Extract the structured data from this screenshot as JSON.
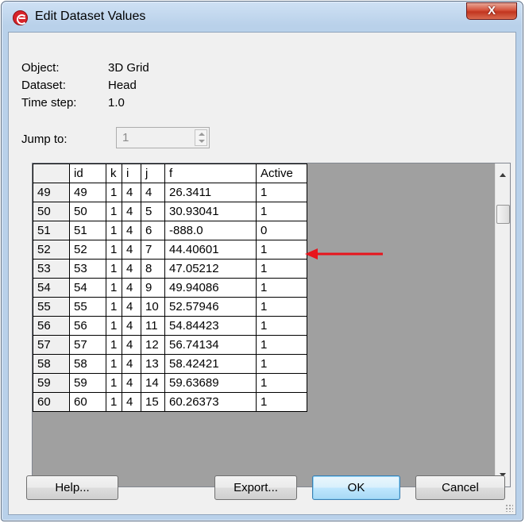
{
  "window": {
    "title": "Edit Dataset Values",
    "close_label": "X"
  },
  "info": {
    "object_label": "Object:",
    "object_value": "3D Grid",
    "dataset_label": "Dataset:",
    "dataset_value": "Head",
    "timestep_label": "Time step:",
    "timestep_value": "1.0"
  },
  "jump": {
    "label": "Jump to:",
    "value": "1"
  },
  "grid": {
    "columns": [
      "",
      "id",
      "k",
      "i",
      "j",
      "f",
      "Active"
    ],
    "rows": [
      [
        "49",
        "49",
        "1",
        "4",
        "4",
        "26.3411",
        "1"
      ],
      [
        "50",
        "50",
        "1",
        "4",
        "5",
        "30.93041",
        "1"
      ],
      [
        "51",
        "51",
        "1",
        "4",
        "6",
        "-888.0",
        "0"
      ],
      [
        "52",
        "52",
        "1",
        "4",
        "7",
        "44.40601",
        "1"
      ],
      [
        "53",
        "53",
        "1",
        "4",
        "8",
        "47.05212",
        "1"
      ],
      [
        "54",
        "54",
        "1",
        "4",
        "9",
        "49.94086",
        "1"
      ],
      [
        "55",
        "55",
        "1",
        "4",
        "10",
        "52.57946",
        "1"
      ],
      [
        "56",
        "56",
        "1",
        "4",
        "11",
        "54.84423",
        "1"
      ],
      [
        "57",
        "57",
        "1",
        "4",
        "12",
        "56.74134",
        "1"
      ],
      [
        "58",
        "58",
        "1",
        "4",
        "13",
        "58.42421",
        "1"
      ],
      [
        "59",
        "59",
        "1",
        "4",
        "14",
        "59.63689",
        "1"
      ],
      [
        "60",
        "60",
        "1",
        "4",
        "15",
        "60.26373",
        "1"
      ]
    ]
  },
  "buttons": {
    "help": "Help...",
    "export": "Export...",
    "ok": "OK",
    "cancel": "Cancel"
  },
  "colors": {
    "annotation_arrow": "#e8141c",
    "grid_background": "#a0a0a0",
    "close_button": "#c2351f"
  },
  "icons": [
    "app-logo-icon",
    "close-icon",
    "spin-up-icon",
    "spin-down-icon",
    "scroll-up-icon",
    "scroll-down-icon",
    "annotation-arrow-icon",
    "resize-grip-icon"
  ]
}
